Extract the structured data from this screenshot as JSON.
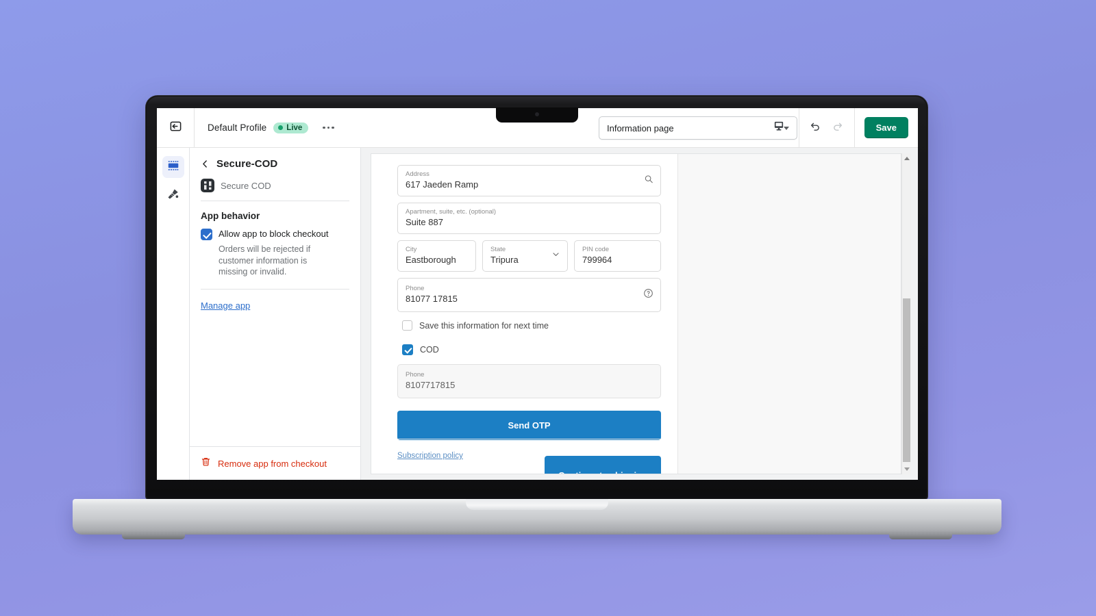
{
  "topbar": {
    "back_icon": "exit-app-icon",
    "profile_name": "Default Profile",
    "live_badge": "Live",
    "more_menu_icon": "ellipsis-icon",
    "page_selector": {
      "value": "Information page",
      "caret_icon": "chevron-down-icon"
    },
    "device_preview_icon": "desktop-preview-icon",
    "undo_icon": "undo-icon",
    "redo_icon": "redo-icon",
    "save_label": "Save"
  },
  "rail": {
    "items": [
      {
        "icon": "sections-layout-icon",
        "active": true
      },
      {
        "icon": "paintbrush-style-icon",
        "active": false
      }
    ]
  },
  "sidebar": {
    "back_icon": "chevron-left-icon",
    "title": "Secure-COD",
    "app_row": {
      "icon": "secure-cod-app-icon",
      "label": "Secure COD"
    },
    "section_title": "App behavior",
    "block_checkout": {
      "label": "Allow app to block checkout",
      "checked": true,
      "help": "Orders will be rejected if customer information is missing or invalid."
    },
    "manage_app_link": "Manage app",
    "remove_app": {
      "icon": "trash-icon",
      "label": "Remove app from checkout"
    }
  },
  "preview": {
    "fields": {
      "address": {
        "label": "Address",
        "value": "617 Jaeden Ramp",
        "adornment": "search-icon"
      },
      "apartment": {
        "label": "Apartment, suite, etc. (optional)",
        "value": "Suite 887"
      },
      "city": {
        "label": "City",
        "value": "Eastborough"
      },
      "state": {
        "label": "State",
        "value": "Tripura",
        "adornment": "chevron-down-icon"
      },
      "pin": {
        "label": "PIN code",
        "value": "799964"
      },
      "phone": {
        "label": "Phone",
        "value": "81077 17815",
        "adornment": "help-circle-icon"
      },
      "cod_phone": {
        "label": "Phone",
        "value": "8107717815",
        "disabled": true
      }
    },
    "save_info_checkbox": {
      "label": "Save this information for next time",
      "checked": false
    },
    "cod_checkbox": {
      "label": "COD",
      "checked": true
    },
    "send_otp_label": "Send OTP",
    "continue_label": "Continue to shipping",
    "subscription_policy_link": "Subscription policy",
    "scrollbar": {
      "up_icon": "scroll-up-arrow-icon",
      "down_icon": "scroll-down-arrow-icon"
    }
  },
  "colors": {
    "brand_green": "#008060",
    "admin_blue": "#2c6ecb",
    "checkout_blue": "#1c7fc4",
    "danger_red": "#d72c0d",
    "live_badge_bg": "#aee9d1",
    "background": "#8e9bea"
  }
}
